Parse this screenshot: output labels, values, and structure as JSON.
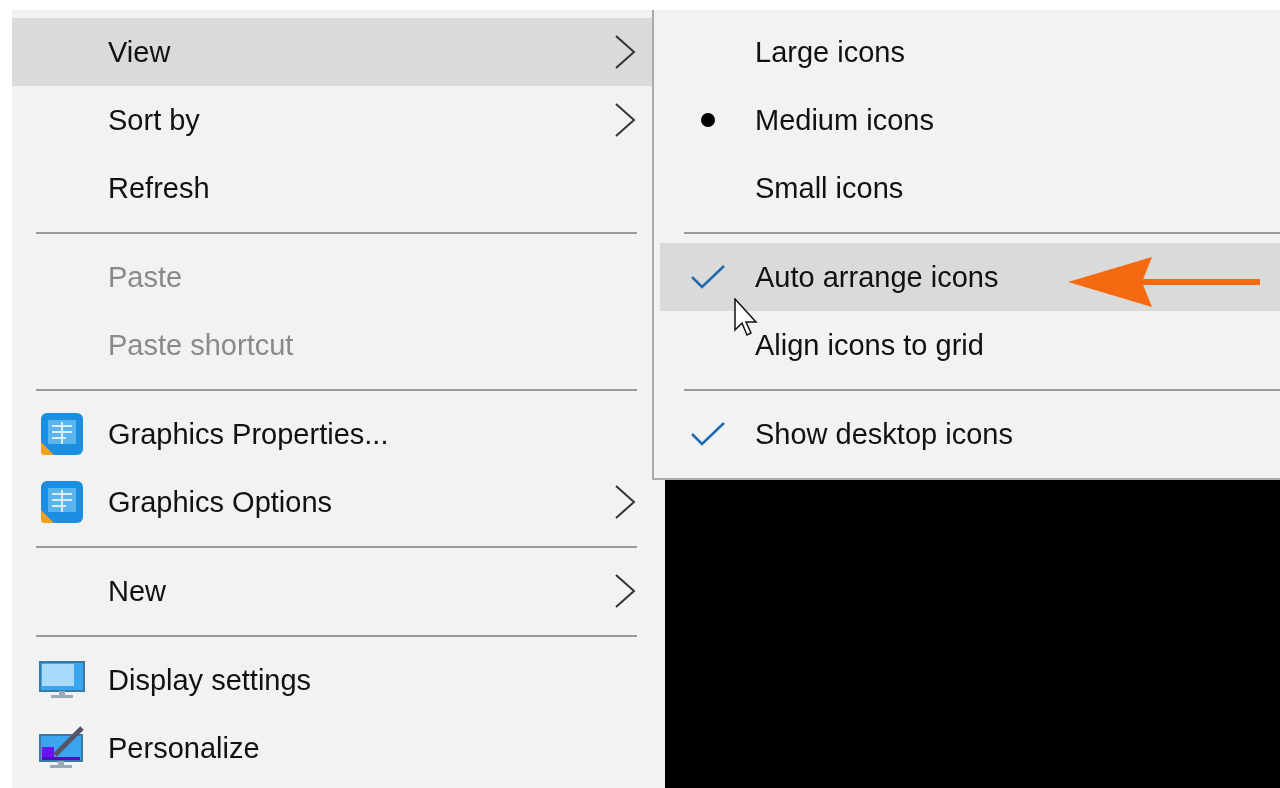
{
  "context_menu": {
    "items": [
      {
        "kind": "plain",
        "label": "View",
        "submenu": true,
        "disabled": false,
        "selected": true
      },
      {
        "kind": "plain",
        "label": "Sort by",
        "submenu": true,
        "disabled": false,
        "selected": false
      },
      {
        "kind": "plain",
        "label": "Refresh",
        "submenu": false,
        "disabled": false,
        "selected": false
      },
      {
        "kind": "separator"
      },
      {
        "kind": "plain",
        "label": "Paste",
        "submenu": false,
        "disabled": true,
        "selected": false
      },
      {
        "kind": "plain",
        "label": "Paste shortcut",
        "submenu": false,
        "disabled": true,
        "selected": false
      },
      {
        "kind": "separator"
      },
      {
        "kind": "graphics",
        "label": "Graphics Properties...",
        "submenu": false,
        "disabled": false,
        "selected": false
      },
      {
        "kind": "graphics",
        "label": "Graphics Options",
        "submenu": true,
        "disabled": false,
        "selected": false
      },
      {
        "kind": "separator"
      },
      {
        "kind": "plain",
        "label": "New",
        "submenu": true,
        "disabled": false,
        "selected": false
      },
      {
        "kind": "separator"
      },
      {
        "kind": "display",
        "label": "Display settings",
        "submenu": false,
        "disabled": false,
        "selected": false
      },
      {
        "kind": "personalize",
        "label": "Personalize",
        "submenu": false,
        "disabled": false,
        "selected": false
      }
    ]
  },
  "view_submenu": {
    "items": [
      {
        "kind": "radio",
        "label": "Large icons",
        "checked": false,
        "selected": false
      },
      {
        "kind": "radio",
        "label": "Medium icons",
        "checked": true,
        "selected": false
      },
      {
        "kind": "radio",
        "label": "Small icons",
        "checked": false,
        "selected": false
      },
      {
        "kind": "separator"
      },
      {
        "kind": "check",
        "label": "Auto arrange icons",
        "checked": true,
        "selected": true
      },
      {
        "kind": "check",
        "label": "Align icons to grid",
        "checked": false,
        "selected": false
      },
      {
        "kind": "separator"
      },
      {
        "kind": "check",
        "label": "Show desktop icons",
        "checked": true,
        "selected": false
      }
    ]
  }
}
